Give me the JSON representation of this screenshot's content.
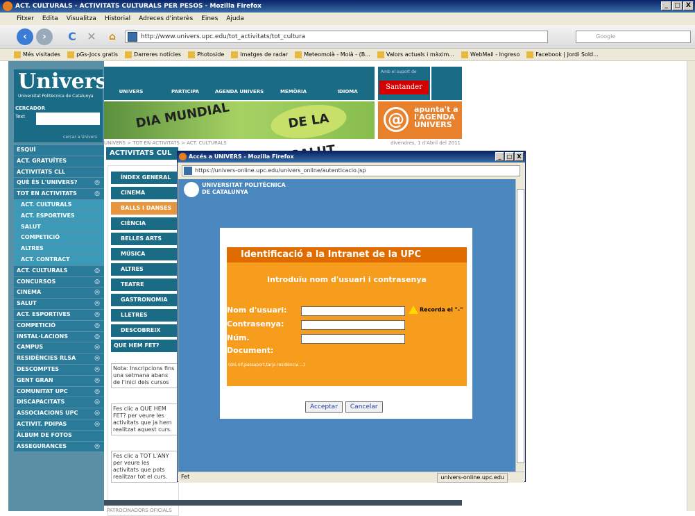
{
  "window": {
    "title": "ACT. CULTURALS - ACTIVITATS CULTURALS PER PESOS - Mozilla Firefox",
    "btns": [
      "_",
      "□",
      "X"
    ]
  },
  "menu": [
    "Fitxer",
    "Edita",
    "Visualitza",
    "Historial",
    "Adreces d'interès",
    "Eines",
    "Ajuda"
  ],
  "nav": {
    "url": "http://www.univers.upc.edu/tot_activitats/tot_cultura",
    "search": "Google"
  },
  "bookmarks": [
    "Més visitades",
    "pGs-Jocs gratis",
    "Darreres notícies",
    "Photoside",
    "Imatges de radar",
    "Meteomoià - Moià - (B...",
    "Valors actuals i màxim...",
    "WebMail - Ingreso",
    "Facebook | Jordi Sold..."
  ],
  "site": {
    "logo": "Univers",
    "logo_sub": "Universitat Politècnica de Catalunya",
    "search_title": "CERCADOR",
    "search_label": "Text",
    "search_go": "cercar a Univers",
    "topnav": [
      "UNIVERS",
      "PARTICIPA",
      "AGENDA UNIVERS",
      "MEMÒRIA",
      "IDIOMA"
    ],
    "suport": "Amb el suport de",
    "santander": "Santander",
    "banner_dia": "DIA MUNDIAL",
    "banner_salut": "DE LA SALUT",
    "apunta": "apunta't a l'AGENDA UNIVERS",
    "breadcrumb": "UNIVERS > TOT EN ACTIVITATS > ACT. CULTURALS",
    "date": "divendres, 1 d'Abril del 2011",
    "content_head": "ACTIVITATS CUL",
    "side": [
      "ESQUÍ",
      "ACT. GRATUÏTES",
      "ACTIVITATS CLL",
      "QUÈ ÉS L'UNIVERS?",
      "TOT EN ACTIVITATS",
      "ACT. CULTURALS",
      "ACT. ESPORTIVES",
      "SALUT",
      "COMPETICIÓ",
      "ALTRES",
      "ACT. CONTRACT",
      "ACT. CULTURALS",
      "CONCURSOS",
      "CINEMA",
      "SALUT",
      "ACT. ESPORTIVES",
      "COMPETICIÓ",
      "INSTAL·LACIONS",
      "CAMPUS",
      "RESIDÈNCIES RLSA",
      "DESCOMPTES",
      "GENT GRAN",
      "COMUNITAT UPC",
      "DISCAPACITATS",
      "ASSOCIACIONS UPC",
      "ACTIVIT. PDIPAS",
      "ÀLBUM DE FOTOS",
      "ASSEGURANCES"
    ],
    "cats": [
      "ÍNDEX GENERAL",
      "CINEMA",
      "BALLS I DANSES",
      "CIÈNCIA",
      "BELLES ARTS",
      "MÚSICA",
      "ALTRES",
      "TEATRE",
      "GASTRONOMIA",
      "LLETRES",
      "DESCOBREIX",
      "QUE HEM FET?"
    ],
    "note1": "Nota: Inscripcions fins una setmana abans de l'inici dels cursos",
    "note2": "Fes clic a QUE HEM FET? per veure les activitats que ja hem realitzat aquest curs.",
    "note3": "Fes clic a TOT L'ANY per veure les activitats que pots realitzar tot el curs.",
    "patro": "PATROCINADORS OFICIALS"
  },
  "popup": {
    "title": "Accés a UNIVERS - Mozilla Firefox",
    "url": "https://univers-online.upc.edu/univers_online/autenticacio.jsp",
    "upc1": "UNIVERSITAT POLITÈCNICA",
    "upc2": "DE CATALUNYA",
    "head": "Identificació a la Intranet de la UPC",
    "sub": "Introduïu nom d'usuari i contrasenya",
    "user": "Nom d'usuari:",
    "pass": "Contrasenya:",
    "num": "Núm.",
    "doc": "Document:",
    "warn": "Recorda el \"-\"",
    "dni": "(dni,nif,passaport,tarja residència ...)",
    "ok": "Acceptar",
    "cancel": "Cancelar",
    "status": "Fet",
    "status_r": "univers-online.upc.edu"
  }
}
